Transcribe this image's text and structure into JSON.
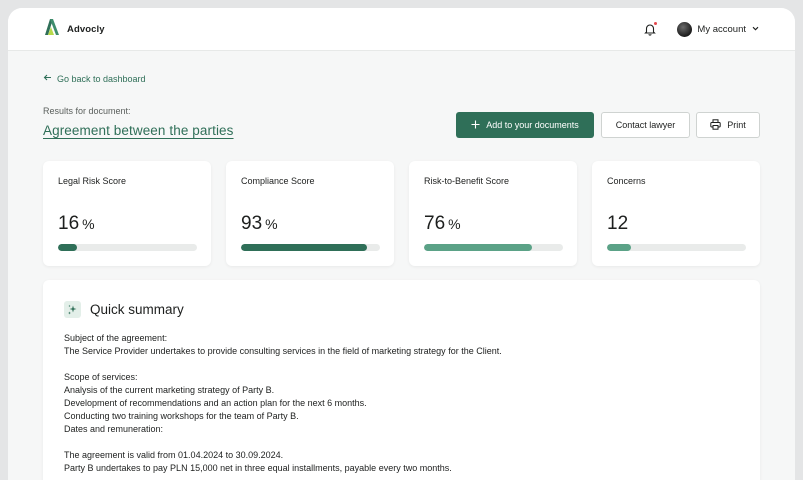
{
  "app": {
    "name": "Advocly"
  },
  "header": {
    "account_label": "My account"
  },
  "nav": {
    "back_label": "Go back to dashboard"
  },
  "document": {
    "results_label": "Results for document:",
    "title": "Agreement between the parties"
  },
  "actions": {
    "add_label": "Add to your documents",
    "contact_label": "Contact lawyer",
    "print_label": "Print"
  },
  "scores": [
    {
      "title": "Legal Risk Score",
      "value": "16",
      "unit": "%",
      "fill": 0.14,
      "color": "#2f6f58"
    },
    {
      "title": "Compliance Score",
      "value": "93",
      "unit": "%",
      "fill": 0.91,
      "color": "#2f6f58"
    },
    {
      "title": "Risk-to-Benefit Score",
      "value": "76",
      "unit": "%",
      "fill": 0.78,
      "color": "#5ba287"
    },
    {
      "title": "Concerns",
      "value": "12",
      "unit": "",
      "fill": 0.17,
      "color": "#5ba287"
    }
  ],
  "summary": {
    "title": "Quick summary",
    "lines": [
      "Subject of the agreement:",
      "The Service Provider undertakes to provide consulting services in the field of marketing strategy for the Client.",
      "",
      "Scope of services:",
      "Analysis of the current marketing strategy of Party B.",
      "Development of recommendations and an action plan for the next 6 months.",
      "Conducting two training workshops for the team of Party B.",
      "Dates and remuneration:",
      "",
      "The agreement is valid from 01.04.2024 to 30.09.2024.",
      "Party B undertakes to pay PLN 15,000 net in three equal installments, payable every two months."
    ]
  },
  "colors": {
    "brand": "#2f6f58",
    "brand_light": "#5ba287",
    "notification": "#e5484d"
  },
  "icons": [
    "advocly-logo-icon",
    "bell-icon",
    "avatar",
    "chevron-down-icon",
    "arrow-left-icon",
    "plus-icon",
    "printer-icon",
    "sparkle-icon"
  ]
}
